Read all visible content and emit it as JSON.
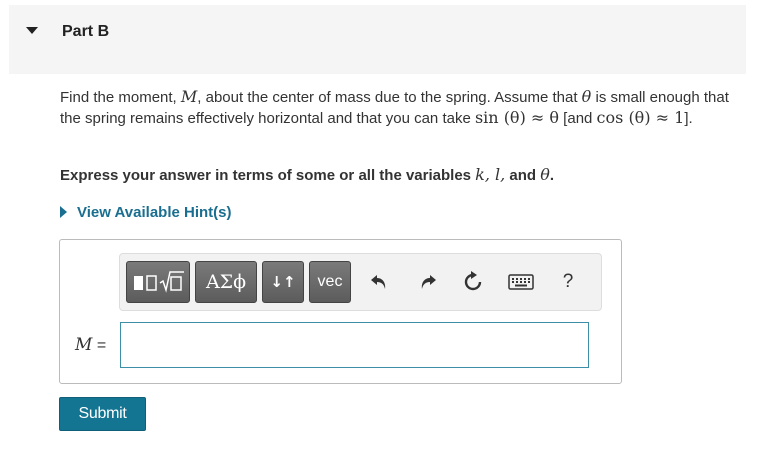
{
  "part": {
    "title": "Part B"
  },
  "problem": {
    "t1": "Find the moment, ",
    "M": "M",
    "t2": ", about the center of mass due to the spring. Assume that ",
    "theta1": "θ",
    "t3": " is small enough that the spring remains effectively horizontal and that you can take ",
    "sin_expr": "sin (θ) ≈ θ",
    "t4": " [and ",
    "cos_expr": "cos (θ) ≈ 1",
    "t5": "]."
  },
  "express": {
    "t1": "Express your answer in terms of some or all the variables ",
    "vars": "k, l,",
    "t2": " and ",
    "theta": "θ",
    "t3": "."
  },
  "hint": {
    "label": "View Available Hint(s)"
  },
  "toolbar": {
    "templates_icon": "templates-icon",
    "greek_label": "ΑΣϕ",
    "arrows_label": "↓↑",
    "vec_label": "vec",
    "undo_icon": "undo-icon",
    "redo_icon": "redo-icon",
    "reset_icon": "reset-icon",
    "keyboard_icon": "keyboard-icon",
    "help_label": "?"
  },
  "answer": {
    "var": "M",
    "eq": " =",
    "value": ""
  },
  "submit": {
    "label": "Submit"
  },
  "colors": {
    "accent": "#147592",
    "link": "#1a6e8f",
    "input_border": "#3d8fa8"
  }
}
